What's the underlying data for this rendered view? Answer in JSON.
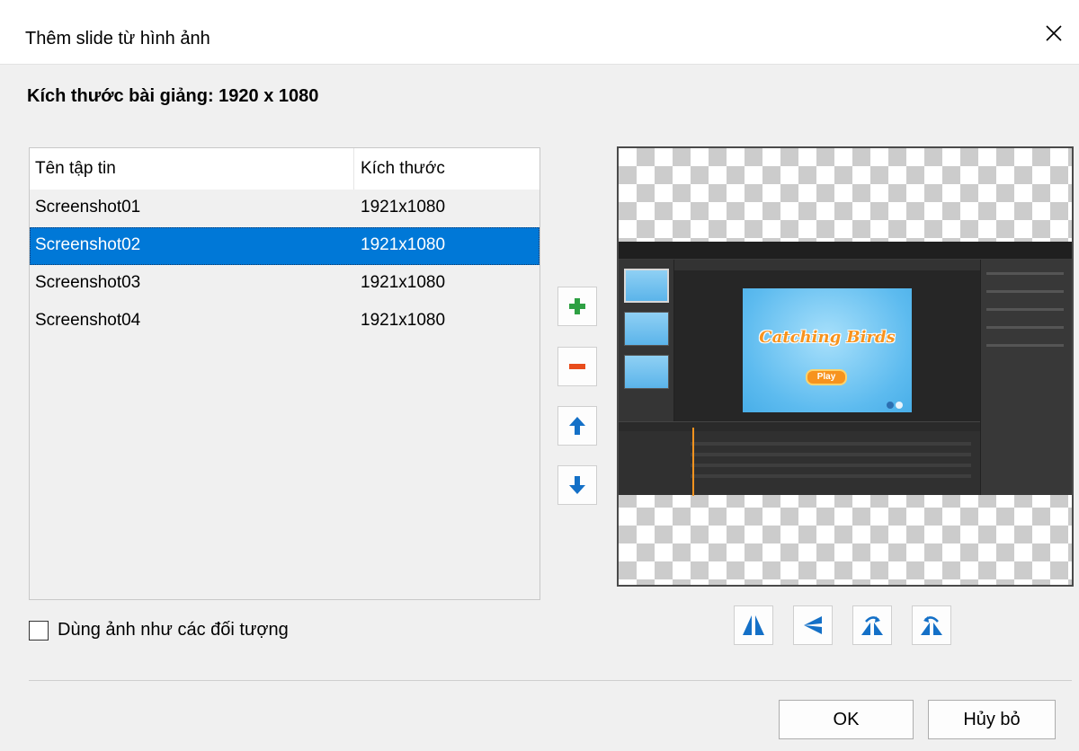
{
  "dialog": {
    "title": "Thêm slide từ hình ảnh",
    "size_label": "Kích thước bài giảng: 1920 x 1080"
  },
  "file_list": {
    "columns": [
      "Tên tập tin",
      "Kích thước"
    ],
    "rows": [
      {
        "name": "Screenshot01",
        "size": "1921x1080",
        "selected": false
      },
      {
        "name": "Screenshot02",
        "size": "1921x1080",
        "selected": true
      },
      {
        "name": "Screenshot03",
        "size": "1921x1080",
        "selected": false
      },
      {
        "name": "Screenshot04",
        "size": "1921x1080",
        "selected": false
      }
    ]
  },
  "side_buttons": [
    {
      "icon": "plus-icon",
      "color": "#2ea043"
    },
    {
      "icon": "minus-icon",
      "color": "#e84c1b"
    },
    {
      "icon": "arrow-up-icon",
      "color": "#1470c7"
    },
    {
      "icon": "arrow-down-icon",
      "color": "#1470c7"
    }
  ],
  "preview": {
    "slide_logo": "Catching Birds",
    "slide_button": "Play"
  },
  "transform_buttons": [
    "flip-horizontal-icon",
    "flip-vertical-icon",
    "rotate-right-icon",
    "rotate-left-icon"
  ],
  "options": {
    "use_as_objects_label": "Dùng ảnh như các đối tượng",
    "use_as_objects_checked": false
  },
  "footer": {
    "ok_label": "OK",
    "cancel_label": "Hủy bỏ"
  },
  "colors": {
    "selection": "#0078d7",
    "icon_blue": "#1470c7",
    "add_green": "#2ea043",
    "remove_red": "#e84c1b"
  }
}
